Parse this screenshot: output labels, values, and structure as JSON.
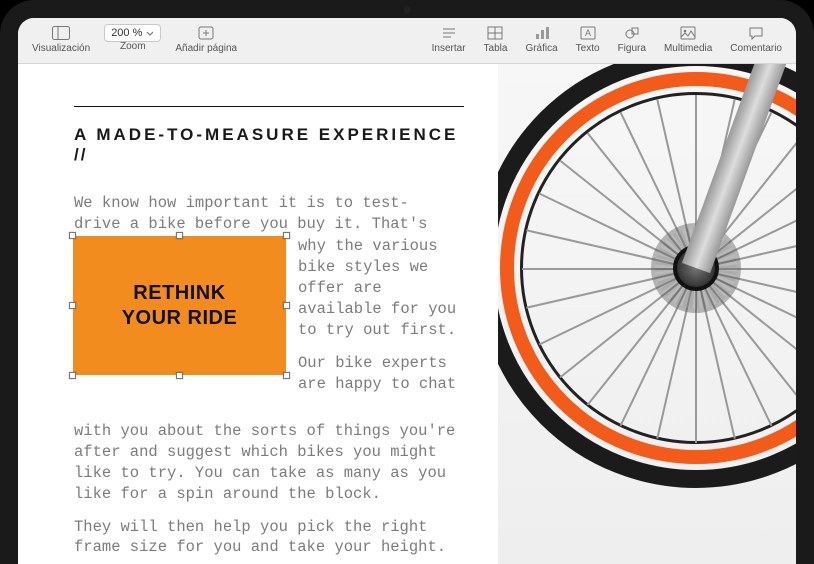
{
  "toolbar": {
    "visualizacion": "Visualización",
    "zoom_label": "Zoom",
    "zoom_value": "200 %",
    "add_page": "Añadir página",
    "insertar": "Insertar",
    "tabla": "Tabla",
    "grafica": "Gráfica",
    "texto": "Texto",
    "figura": "Figura",
    "multimedia": "Multimedia",
    "comentario": "Comentario"
  },
  "doc": {
    "heading": "A MADE-TO-MEASURE EXPERIENCE",
    "heading_suffix": " //",
    "p1_l1": "We know how important it is to test-",
    "p1_l2": "drive a bike before you buy it. That's",
    "p1_right": "why the various bike styles we offer are available for you to try out first.",
    "p2_right": "Our bike experts are happy to chat",
    "p2_cont": "with you about the sorts of things you're after and suggest which bikes you might like to try. You can take as many as you like for a spin around the block.",
    "p3": "They will then help you pick the right frame size for you and take your height.",
    "callout_l1": "RETHINK",
    "callout_l2": "YOUR RIDE"
  },
  "colors": {
    "callout_bg": "#f28c1e",
    "rim": "#f25b1a"
  },
  "icons": {
    "visualizacion": "sidebar-layout-icon",
    "add_page": "plus-page-icon",
    "insertar": "lines-icon",
    "tabla": "table-grid-icon",
    "grafica": "bar-chart-icon",
    "texto": "text-box-icon",
    "figura": "shapes-icon",
    "multimedia": "image-icon",
    "comentario": "comment-bubble-icon"
  },
  "image": {
    "description": "bicycle-wheel-orange-rim"
  }
}
